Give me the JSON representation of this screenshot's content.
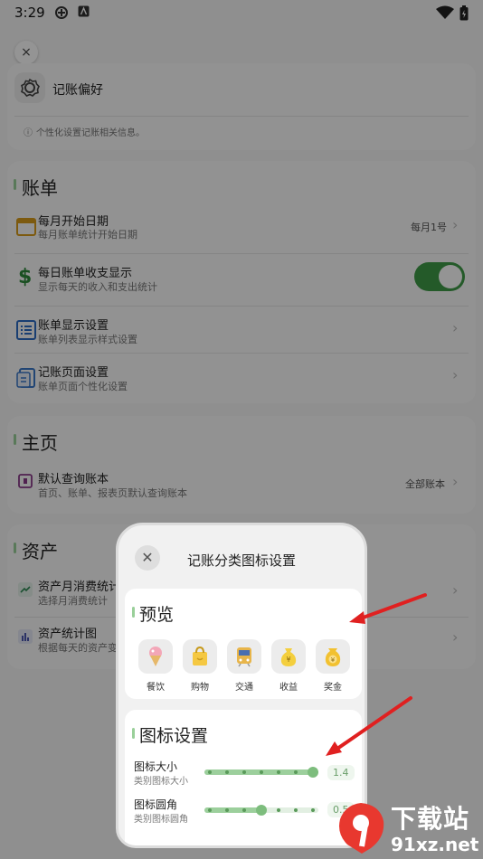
{
  "status_bar": {
    "time": "3:29"
  },
  "prefs": {
    "close_glyph": "×",
    "title": "记账偏好",
    "info": "个性化设置记账相关信息。"
  },
  "bills": {
    "title": "账单",
    "rows": [
      {
        "title": "每月开始日期",
        "sub": "每月账单统计开始日期",
        "value": "每月1号"
      },
      {
        "title": "每日账单收支显示",
        "sub": "显示每天的收入和支出统计",
        "value": ""
      },
      {
        "title": "账单显示设置",
        "sub": "账单列表显示样式设置",
        "value": ""
      },
      {
        "title": "记账页面设置",
        "sub": "账单页面个性化设置",
        "value": ""
      }
    ],
    "toggle_on": true
  },
  "home": {
    "title": "主页",
    "rows": [
      {
        "title": "默认查询账本",
        "sub": "首页、账单、报表页默认查询账本",
        "value": "全部账本"
      }
    ]
  },
  "assets": {
    "title": "资产",
    "rows": [
      {
        "title": "资产月消费统计",
        "sub": "选择月消费统计"
      },
      {
        "title": "资产统计图",
        "sub": "根据每天的资产变"
      }
    ]
  },
  "dialog": {
    "close_glyph": "✕",
    "title": "记账分类图标设置",
    "preview": {
      "title": "预览",
      "categories": [
        {
          "label": "餐饮",
          "icon": "ice-cream-icon"
        },
        {
          "label": "购物",
          "icon": "shopping-bag-icon"
        },
        {
          "label": "交通",
          "icon": "subway-icon"
        },
        {
          "label": "收益",
          "icon": "money-bag-icon"
        },
        {
          "label": "奖金",
          "icon": "bonus-coin-icon"
        }
      ]
    },
    "icon_settings": {
      "title": "图标设置",
      "size": {
        "title": "图标大小",
        "sub": "类别图标大小",
        "value": "1.4",
        "level": 1.0
      },
      "radius": {
        "title": "图标圆角",
        "sub": "类别图标圆角",
        "value": "0.5",
        "level": 0.5
      }
    }
  },
  "watermark": {
    "brand": "下载站",
    "site": "91xz.net"
  },
  "colors": {
    "accent_green": "#4caf50",
    "toggle_green": "#3f9b47",
    "arrow_red": "#e02020"
  }
}
